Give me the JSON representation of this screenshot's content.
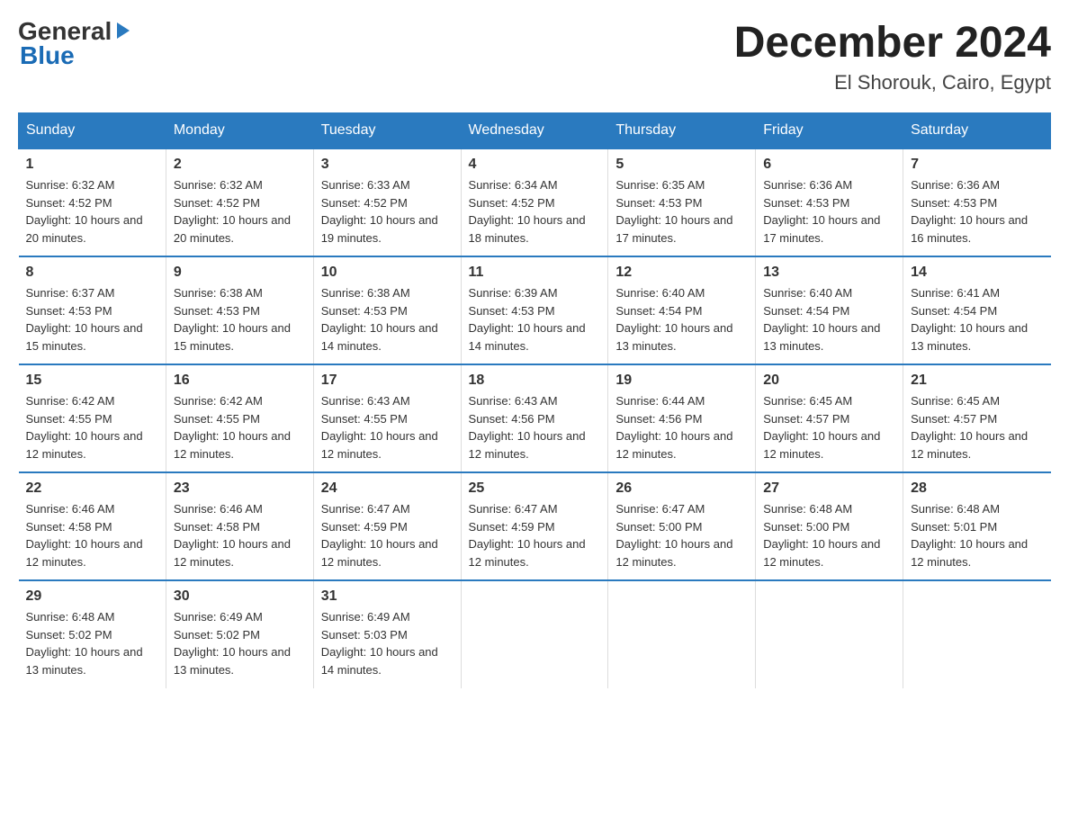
{
  "logo": {
    "text_general": "General",
    "text_blue": "Blue",
    "arrow": "▶"
  },
  "title": "December 2024",
  "location": "El Shorouk, Cairo, Egypt",
  "weekdays": [
    "Sunday",
    "Monday",
    "Tuesday",
    "Wednesday",
    "Thursday",
    "Friday",
    "Saturday"
  ],
  "weeks": [
    [
      {
        "day": "1",
        "sunrise": "6:32 AM",
        "sunset": "4:52 PM",
        "daylight": "10 hours and 20 minutes."
      },
      {
        "day": "2",
        "sunrise": "6:32 AM",
        "sunset": "4:52 PM",
        "daylight": "10 hours and 20 minutes."
      },
      {
        "day": "3",
        "sunrise": "6:33 AM",
        "sunset": "4:52 PM",
        "daylight": "10 hours and 19 minutes."
      },
      {
        "day": "4",
        "sunrise": "6:34 AM",
        "sunset": "4:52 PM",
        "daylight": "10 hours and 18 minutes."
      },
      {
        "day": "5",
        "sunrise": "6:35 AM",
        "sunset": "4:53 PM",
        "daylight": "10 hours and 17 minutes."
      },
      {
        "day": "6",
        "sunrise": "6:36 AM",
        "sunset": "4:53 PM",
        "daylight": "10 hours and 17 minutes."
      },
      {
        "day": "7",
        "sunrise": "6:36 AM",
        "sunset": "4:53 PM",
        "daylight": "10 hours and 16 minutes."
      }
    ],
    [
      {
        "day": "8",
        "sunrise": "6:37 AM",
        "sunset": "4:53 PM",
        "daylight": "10 hours and 15 minutes."
      },
      {
        "day": "9",
        "sunrise": "6:38 AM",
        "sunset": "4:53 PM",
        "daylight": "10 hours and 15 minutes."
      },
      {
        "day": "10",
        "sunrise": "6:38 AM",
        "sunset": "4:53 PM",
        "daylight": "10 hours and 14 minutes."
      },
      {
        "day": "11",
        "sunrise": "6:39 AM",
        "sunset": "4:53 PM",
        "daylight": "10 hours and 14 minutes."
      },
      {
        "day": "12",
        "sunrise": "6:40 AM",
        "sunset": "4:54 PM",
        "daylight": "10 hours and 13 minutes."
      },
      {
        "day": "13",
        "sunrise": "6:40 AM",
        "sunset": "4:54 PM",
        "daylight": "10 hours and 13 minutes."
      },
      {
        "day": "14",
        "sunrise": "6:41 AM",
        "sunset": "4:54 PM",
        "daylight": "10 hours and 13 minutes."
      }
    ],
    [
      {
        "day": "15",
        "sunrise": "6:42 AM",
        "sunset": "4:55 PM",
        "daylight": "10 hours and 12 minutes."
      },
      {
        "day": "16",
        "sunrise": "6:42 AM",
        "sunset": "4:55 PM",
        "daylight": "10 hours and 12 minutes."
      },
      {
        "day": "17",
        "sunrise": "6:43 AM",
        "sunset": "4:55 PM",
        "daylight": "10 hours and 12 minutes."
      },
      {
        "day": "18",
        "sunrise": "6:43 AM",
        "sunset": "4:56 PM",
        "daylight": "10 hours and 12 minutes."
      },
      {
        "day": "19",
        "sunrise": "6:44 AM",
        "sunset": "4:56 PM",
        "daylight": "10 hours and 12 minutes."
      },
      {
        "day": "20",
        "sunrise": "6:45 AM",
        "sunset": "4:57 PM",
        "daylight": "10 hours and 12 minutes."
      },
      {
        "day": "21",
        "sunrise": "6:45 AM",
        "sunset": "4:57 PM",
        "daylight": "10 hours and 12 minutes."
      }
    ],
    [
      {
        "day": "22",
        "sunrise": "6:46 AM",
        "sunset": "4:58 PM",
        "daylight": "10 hours and 12 minutes."
      },
      {
        "day": "23",
        "sunrise": "6:46 AM",
        "sunset": "4:58 PM",
        "daylight": "10 hours and 12 minutes."
      },
      {
        "day": "24",
        "sunrise": "6:47 AM",
        "sunset": "4:59 PM",
        "daylight": "10 hours and 12 minutes."
      },
      {
        "day": "25",
        "sunrise": "6:47 AM",
        "sunset": "4:59 PM",
        "daylight": "10 hours and 12 minutes."
      },
      {
        "day": "26",
        "sunrise": "6:47 AM",
        "sunset": "5:00 PM",
        "daylight": "10 hours and 12 minutes."
      },
      {
        "day": "27",
        "sunrise": "6:48 AM",
        "sunset": "5:00 PM",
        "daylight": "10 hours and 12 minutes."
      },
      {
        "day": "28",
        "sunrise": "6:48 AM",
        "sunset": "5:01 PM",
        "daylight": "10 hours and 12 minutes."
      }
    ],
    [
      {
        "day": "29",
        "sunrise": "6:48 AM",
        "sunset": "5:02 PM",
        "daylight": "10 hours and 13 minutes."
      },
      {
        "day": "30",
        "sunrise": "6:49 AM",
        "sunset": "5:02 PM",
        "daylight": "10 hours and 13 minutes."
      },
      {
        "day": "31",
        "sunrise": "6:49 AM",
        "sunset": "5:03 PM",
        "daylight": "10 hours and 14 minutes."
      },
      null,
      null,
      null,
      null
    ]
  ]
}
